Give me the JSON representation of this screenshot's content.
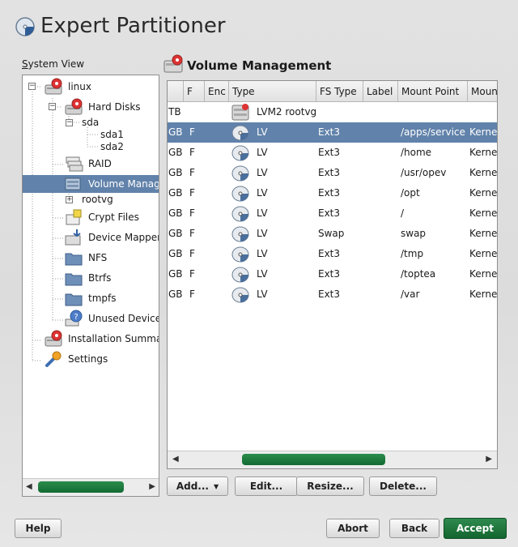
{
  "window": {
    "title": "Expert Partitioner"
  },
  "tree": {
    "label": "System View",
    "label_mnemonic": "S",
    "label_rest": "ystem View",
    "items": [
      {
        "label": "linux",
        "icon": "harddisk-icon"
      },
      {
        "label": "Hard Disks",
        "icon": "harddisk-icon"
      },
      {
        "label": "sda",
        "icon": "none"
      },
      {
        "label": "sda1",
        "icon": "none"
      },
      {
        "label": "sda2",
        "icon": "none"
      },
      {
        "label": "RAID",
        "icon": "raid-icon"
      },
      {
        "label": "Volume Manage",
        "icon": "volume-icon",
        "selected": true
      },
      {
        "label": "rootvg",
        "icon": "none"
      },
      {
        "label": "Crypt Files",
        "icon": "crypt-icon"
      },
      {
        "label": "Device Mapper",
        "icon": "device-mapper-icon"
      },
      {
        "label": "NFS",
        "icon": "folder-icon"
      },
      {
        "label": "Btrfs",
        "icon": "folder-icon"
      },
      {
        "label": "tmpfs",
        "icon": "folder-icon"
      },
      {
        "label": "Unused Device",
        "icon": "question-icon"
      },
      {
        "label": "Installation Summa",
        "icon": "harddisk-icon"
      },
      {
        "label": "Settings",
        "icon": "wrench-icon"
      }
    ]
  },
  "main": {
    "title": "Volume Management",
    "columns": [
      "",
      "F",
      "Enc",
      "Type",
      "FS Type",
      "Label",
      "Mount Point",
      "Moun"
    ],
    "rows": [
      {
        "size": "TB",
        "f": "",
        "enc": "",
        "type": "LVM2 rootvg",
        "fstype": "",
        "label": "",
        "mount": "",
        "mountby": "",
        "icon": "lvm-icon",
        "selected": false
      },
      {
        "size": "GB",
        "f": "F",
        "enc": "",
        "type": "LV",
        "fstype": "Ext3",
        "label": "",
        "mount": "/apps/service",
        "mountby": "Kerne",
        "icon": "lv-icon",
        "selected": true
      },
      {
        "size": "GB",
        "f": "F",
        "enc": "",
        "type": "LV",
        "fstype": "Ext3",
        "label": "",
        "mount": "/home",
        "mountby": "Kerne",
        "icon": "lv-icon",
        "selected": false
      },
      {
        "size": "GB",
        "f": "F",
        "enc": "",
        "type": "LV",
        "fstype": "Ext3",
        "label": "",
        "mount": "/usr/opev",
        "mountby": "Kerne",
        "icon": "lv-icon",
        "selected": false
      },
      {
        "size": "GB",
        "f": "F",
        "enc": "",
        "type": "LV",
        "fstype": "Ext3",
        "label": "",
        "mount": "/opt",
        "mountby": "Kerne",
        "icon": "lv-icon",
        "selected": false
      },
      {
        "size": "GB",
        "f": "F",
        "enc": "",
        "type": "LV",
        "fstype": "Ext3",
        "label": "",
        "mount": "/",
        "mountby": "Kerne",
        "icon": "lv-icon",
        "selected": false
      },
      {
        "size": "GB",
        "f": "F",
        "enc": "",
        "type": "LV",
        "fstype": "Swap",
        "label": "",
        "mount": "swap",
        "mountby": "Kerne",
        "icon": "lv-icon",
        "selected": false
      },
      {
        "size": "GB",
        "f": "F",
        "enc": "",
        "type": "LV",
        "fstype": "Ext3",
        "label": "",
        "mount": "/tmp",
        "mountby": "Kerne",
        "icon": "lv-icon",
        "selected": false
      },
      {
        "size": "GB",
        "f": "F",
        "enc": "",
        "type": "LV",
        "fstype": "Ext3",
        "label": "",
        "mount": "/toptea",
        "mountby": "Kerne",
        "icon": "lv-icon",
        "selected": false
      },
      {
        "size": "GB",
        "f": "F",
        "enc": "",
        "type": "LV",
        "fstype": "Ext3",
        "label": "",
        "mount": "/var",
        "mountby": "Kerne",
        "icon": "lv-icon",
        "selected": false
      }
    ],
    "actions": {
      "add": "Add...",
      "edit": "Edit...",
      "resize": "Resize...",
      "delete": "Delete..."
    }
  },
  "footer": {
    "help": "Help",
    "abort": "Abort",
    "back": "Back",
    "accept": "Accept"
  },
  "colors": {
    "selection": "#6182aa",
    "accent": "#1d7a3c"
  }
}
